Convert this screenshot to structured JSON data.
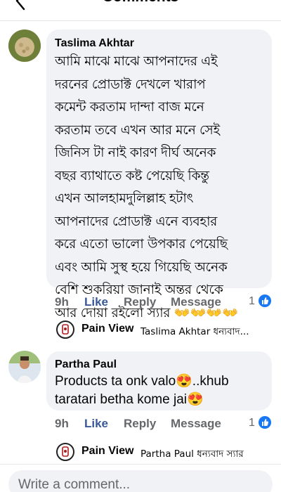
{
  "header": {
    "title": "Comments"
  },
  "comments": [
    {
      "author": "Taslima Akhtar",
      "lines": [
        "আমি মাঝে মাঝে আপনাদের  এই",
        "দরনের  প্রোডাক্ট দেখলে খারাপ",
        "কমেন্ট  করতাম দান্দা বাজ মনে",
        "করতাম তবে এখন আর মনে সেই",
        "জিনিস টা নাই কারণ দীর্ঘ  অনেক",
        "বছর ব্যাথাতে কষ্ট পেয়েছি কিন্তু",
        "এখন আলহামদুলিল্লাহ হটাৎ",
        "আপনাদের  প্রোডাক্ট এনে ব্যবহার",
        "করে এতো ভালো উপকার পেয়েছি",
        "এবং আমি সুস্থ হয়ে গিয়েছি অনেক",
        "বেশি শুকরিয়া জানাই অন্তর থেকে",
        "আর দোয়া রইলো স্যার 👐👐👐👐"
      ],
      "time": "9h",
      "like": "Like",
      "reply": "Reply",
      "message": "Message",
      "reactions": "1",
      "reply_preview": {
        "name": "Pain View",
        "text": "Taslima Akhtar ধন্যবাদ..."
      }
    },
    {
      "author": "Partha Paul",
      "lines": [
        "Products ta onk valo😍..khub",
        "taratari betha kome jai😍"
      ],
      "time": "9h",
      "like": "Like",
      "reply": "Reply",
      "message": "Message",
      "reactions": "1",
      "reply_preview": {
        "name": "Pain View",
        "text": "Partha Paul ধন্যবাদ স্যার"
      }
    }
  ],
  "composer": {
    "placeholder": "Write a comment..."
  },
  "colors": {
    "bubble": "#f0f2f5",
    "link": "#385898",
    "meta": "#65676b",
    "like_badge": "#1877f2"
  },
  "icons": {
    "back": "arrow-left-icon",
    "like_badge": "thumbs-up-icon"
  }
}
